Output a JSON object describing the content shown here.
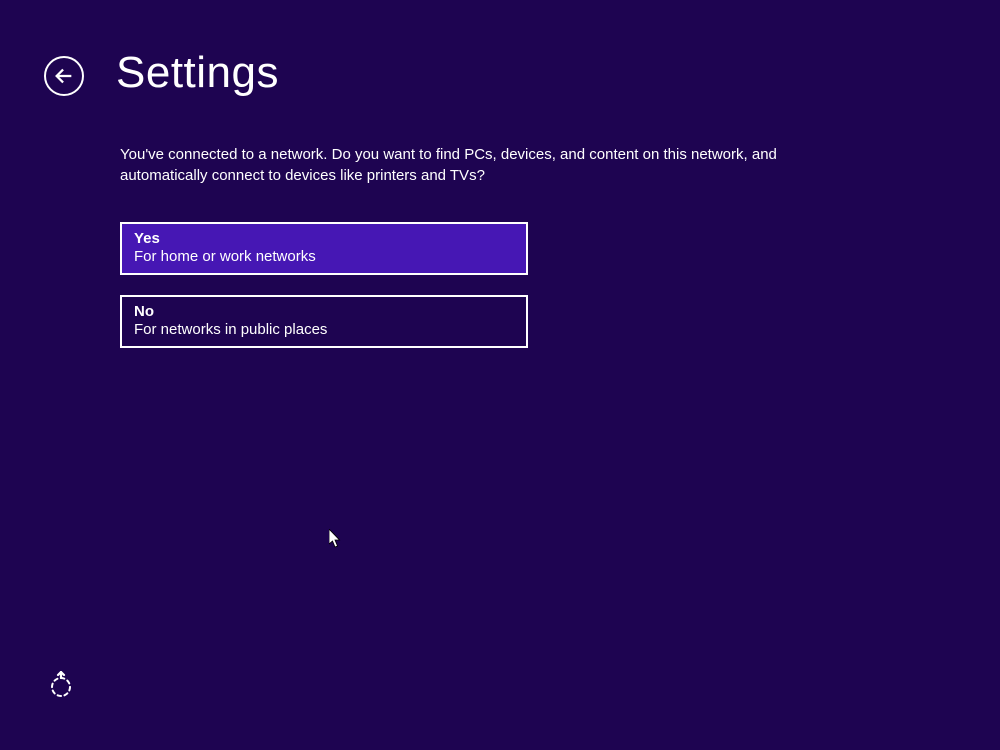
{
  "header": {
    "title": "Settings"
  },
  "description": "You've connected to a network. Do you want to find PCs, devices, and content on this network, and automatically connect to devices like printers and TVs?",
  "options": {
    "yes": {
      "title": "Yes",
      "subtitle": "For home or work networks"
    },
    "no": {
      "title": "No",
      "subtitle": "For networks in public places"
    }
  }
}
